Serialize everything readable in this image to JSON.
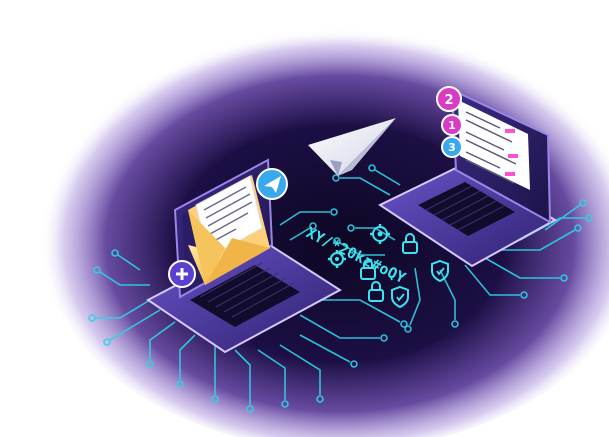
{
  "illustration": {
    "cipher_text": "XY/*20kz#oQY",
    "step_badges": [
      "2",
      "1",
      "3"
    ],
    "colors": {
      "background": "#ffffff",
      "glow_inner": "#150a33",
      "glow_outer": "#6a3fb0",
      "circuit": "#2fd3e8",
      "laptop_body": "#2a1b5c",
      "laptop_edge": "#c7b6ff",
      "keyboard": "#0f0b24",
      "envelope": "#ffd87a",
      "badge_magenta": "#d83bc4",
      "badge_blue": "#3aa8f0",
      "accent_pink": "#ff4fd8"
    },
    "icons": [
      "paper-plane-icon",
      "envelope-icon",
      "send-badge-icon",
      "plus-badge-icon",
      "gear-icon",
      "padlock-icon",
      "shield-icon"
    ]
  }
}
